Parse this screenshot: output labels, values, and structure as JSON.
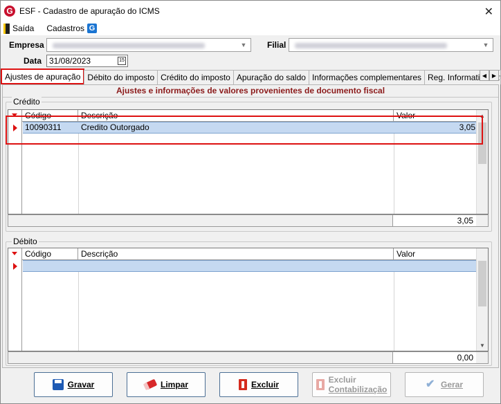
{
  "window": {
    "title": "ESF - Cadastro de apuração do ICMS",
    "app_icon_letter": "G",
    "close_glyph": "✕"
  },
  "menu": {
    "items": [
      {
        "label": "Saída",
        "icon": "exit-door-icon"
      },
      {
        "label": "Cadastros",
        "icon": "app-g-icon"
      }
    ],
    "g_icon_letter": "G"
  },
  "form": {
    "empresa_label": "Empresa",
    "filial_label": "Filial",
    "data_label": "Data",
    "data_value": "31/08/2023",
    "calendar_glyph": "15"
  },
  "tabs": [
    {
      "label": "Ajustes de apuração",
      "active": true
    },
    {
      "label": "Débito do imposto",
      "active": false
    },
    {
      "label": "Crédito do imposto",
      "active": false
    },
    {
      "label": "Apuração do saldo",
      "active": false
    },
    {
      "label": "Informações complementares",
      "active": false
    },
    {
      "label": "Reg. Informativo extra apu",
      "active": false
    }
  ],
  "panel": {
    "header": "Ajustes e informações de valores provenientes de documento fiscal"
  },
  "credito": {
    "group_title": "Crédito",
    "columns": [
      "Código",
      "Descrição",
      "Valor"
    ],
    "rows": [
      {
        "codigo": "10090311",
        "descricao": "Credito Outorgado",
        "valor": "3,05"
      }
    ],
    "total": "3,05"
  },
  "debito": {
    "group_title": "Débito",
    "columns": [
      "Código",
      "Descrição",
      "Valor"
    ],
    "rows": [],
    "total": "0,00"
  },
  "buttons": {
    "gravar": {
      "label": "Gravar",
      "enabled": true
    },
    "limpar": {
      "label": "Limpar",
      "enabled": true
    },
    "excluir": {
      "label": "Excluir",
      "enabled": true
    },
    "excluir_contab": {
      "line1": "Excluir",
      "line2": "Contabilização",
      "enabled": false
    },
    "gerar": {
      "label": "Gerar",
      "enabled": false
    }
  },
  "colors": {
    "accent_red": "#dd1111",
    "header_text": "#8b1a1a",
    "selected_row": "#c5d9f1"
  }
}
